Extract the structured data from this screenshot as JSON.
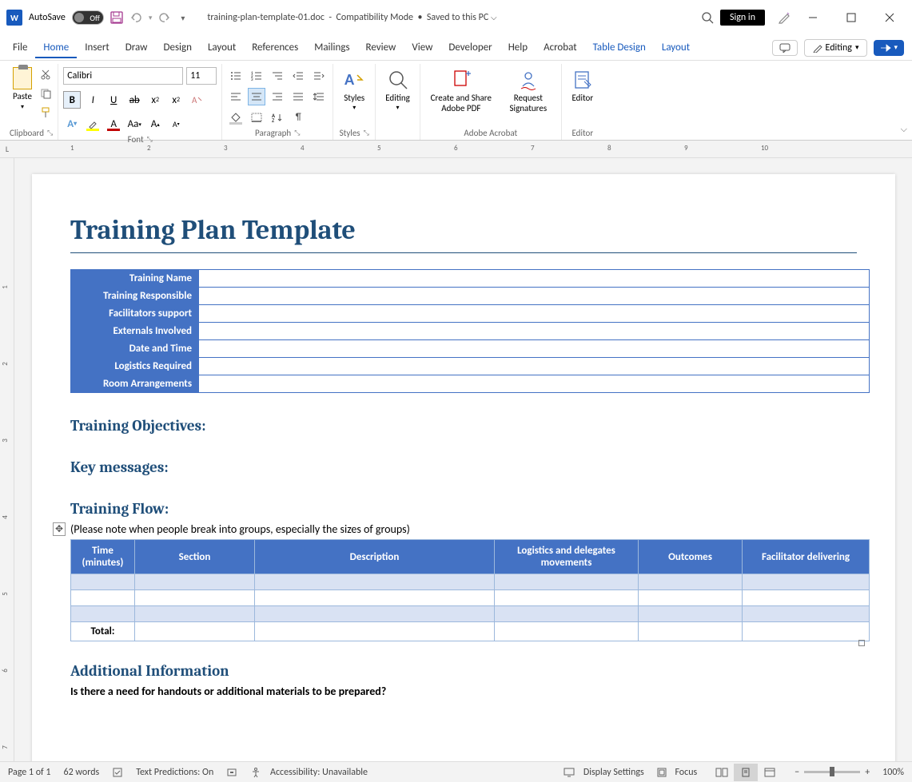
{
  "titlebar": {
    "autosave_label": "AutoSave",
    "autosave_state": "Off",
    "filename": "training-plan-template-01.doc",
    "separator": "-",
    "mode": "Compatibility Mode",
    "dot": "•",
    "saved": "Saved to this PC",
    "signin": "Sign in"
  },
  "tabs": {
    "file": "File",
    "home": "Home",
    "insert": "Insert",
    "draw": "Draw",
    "design": "Design",
    "layout": "Layout",
    "references": "References",
    "mailings": "Mailings",
    "review": "Review",
    "view": "View",
    "developer": "Developer",
    "help": "Help",
    "acrobat": "Acrobat",
    "table_design": "Table Design",
    "tlayout": "Layout",
    "editing_mode": "Editing"
  },
  "ribbon": {
    "paste": "Paste",
    "clipboard": "Clipboard",
    "font_name": "Calibri",
    "font_size": "11",
    "font_group": "Font",
    "paragraph_group": "Paragraph",
    "styles": "Styles",
    "styles_group": "Styles",
    "editing": "Editing",
    "create_share": "Create and Share Adobe PDF",
    "request_sig": "Request Signatures",
    "adobe_group": "Adobe Acrobat",
    "editor": "Editor",
    "editor_group": "Editor"
  },
  "ruler": {
    "marks": [
      "1",
      "2",
      "3",
      "4",
      "5",
      "6",
      "7",
      "8",
      "9",
      "10"
    ]
  },
  "document": {
    "title": "Training Plan Template",
    "info_rows": [
      "Training Name",
      "Training Responsible",
      "Facilitators support",
      "Externals Involved",
      "Date and Time",
      "Logistics Required",
      "Room Arrangements"
    ],
    "objectives_h": "Training Objectives:",
    "key_h": "Key messages:",
    "flow_h": "Training Flow:",
    "flow_note": "(Please note when people break into groups, especially the sizes of groups)",
    "flow_cols": {
      "time": "Time (minutes)",
      "section": "Section",
      "description": "Description",
      "logistics": "Logistics and delegates movements",
      "outcomes": "Outcomes",
      "facilitator": "Facilitator delivering"
    },
    "total_label": "Total:",
    "addl_h": "Additional Information",
    "addl_q": "Is there a need for handouts or additional materials to be prepared?"
  },
  "statusbar": {
    "page": "Page 1 of 1",
    "words": "62 words",
    "predictions": "Text Predictions: On",
    "accessibility": "Accessibility: Unavailable",
    "display": "Display Settings",
    "focus": "Focus",
    "zoom": "100%"
  }
}
